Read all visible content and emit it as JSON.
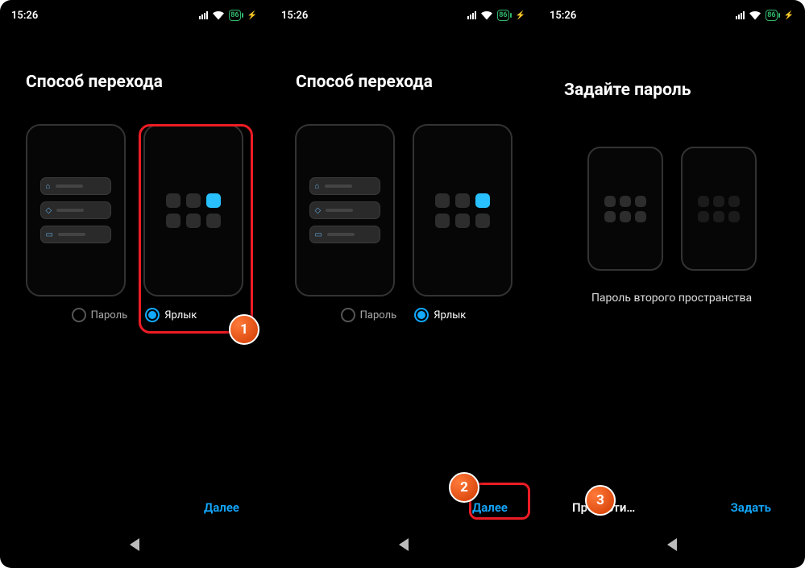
{
  "status": {
    "time": "15:26",
    "battery": "86"
  },
  "panel1": {
    "heading": "Способ перехода",
    "options": {
      "password": "Пароль",
      "shortcut": "Ярлык",
      "selected": "shortcut"
    },
    "action_next": "Далее",
    "annotation_badge": "1"
  },
  "panel2": {
    "heading": "Способ перехода",
    "options": {
      "password": "Пароль",
      "shortcut": "Ярлык",
      "selected": "shortcut"
    },
    "action_next": "Далее",
    "annotation_badge": "2"
  },
  "panel3": {
    "heading": "Задайте пароль",
    "subtext": "Пароль второго пространства",
    "action_skip": "Пропусти…",
    "action_set": "Задать",
    "annotation_badge": "3"
  }
}
